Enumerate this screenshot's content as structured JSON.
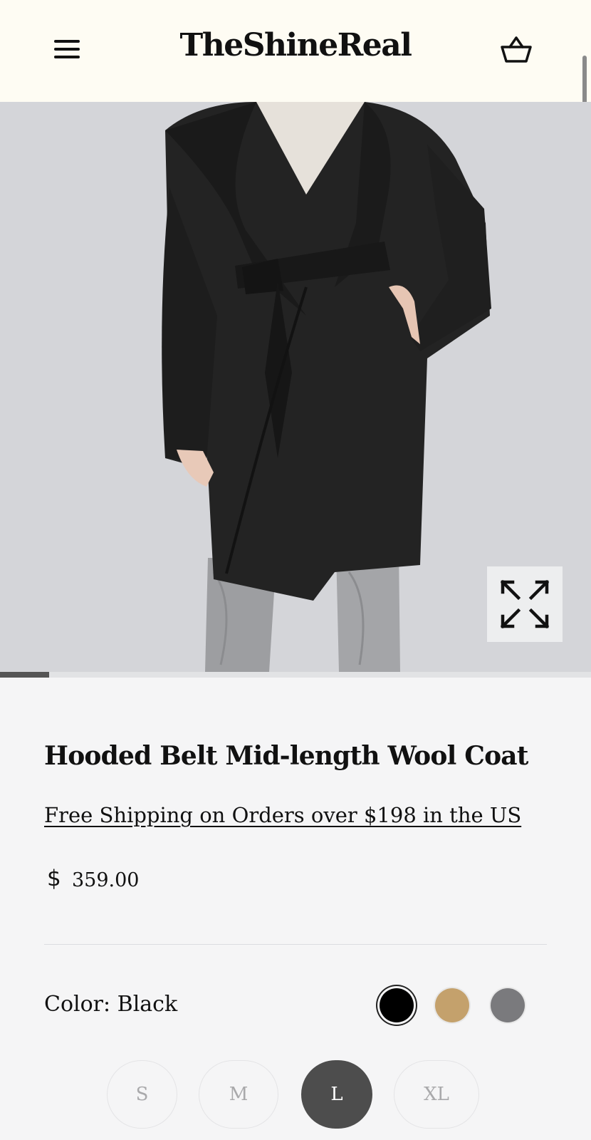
{
  "header": {
    "logo": "TheShineReal",
    "menu_icon": "hamburger-menu-icon",
    "cart_icon": "shopping-basket-icon"
  },
  "gallery": {
    "image_subject": "Black hooded belted wool coat worn by model",
    "zoom_icon": "expand-arrows-icon",
    "progress_fraction": 0.083
  },
  "product": {
    "title": "Hooded Belt Mid-length Wool Coat",
    "shipping_link": "Free Shipping on Orders over $198 in the US",
    "currency_symbol": "$",
    "price": "359.00"
  },
  "color": {
    "label": "Color: Black",
    "swatches": [
      {
        "name": "Black",
        "hex": "#000000",
        "selected": true
      },
      {
        "name": "Camel",
        "hex": "#c4a16c",
        "selected": false
      },
      {
        "name": "Grey",
        "hex": "#7a7a7d",
        "selected": false
      }
    ]
  },
  "sizes": [
    {
      "label": "S",
      "selected": false
    },
    {
      "label": "M",
      "selected": false
    },
    {
      "label": "L",
      "selected": true
    },
    {
      "label": "XL",
      "selected": false
    }
  ],
  "colors": {
    "header_bg": "#fefcf3",
    "page_bg": "#f5f5f6",
    "image_bg": "#d4d5d9",
    "selected_size_bg": "#4d4d4d"
  }
}
